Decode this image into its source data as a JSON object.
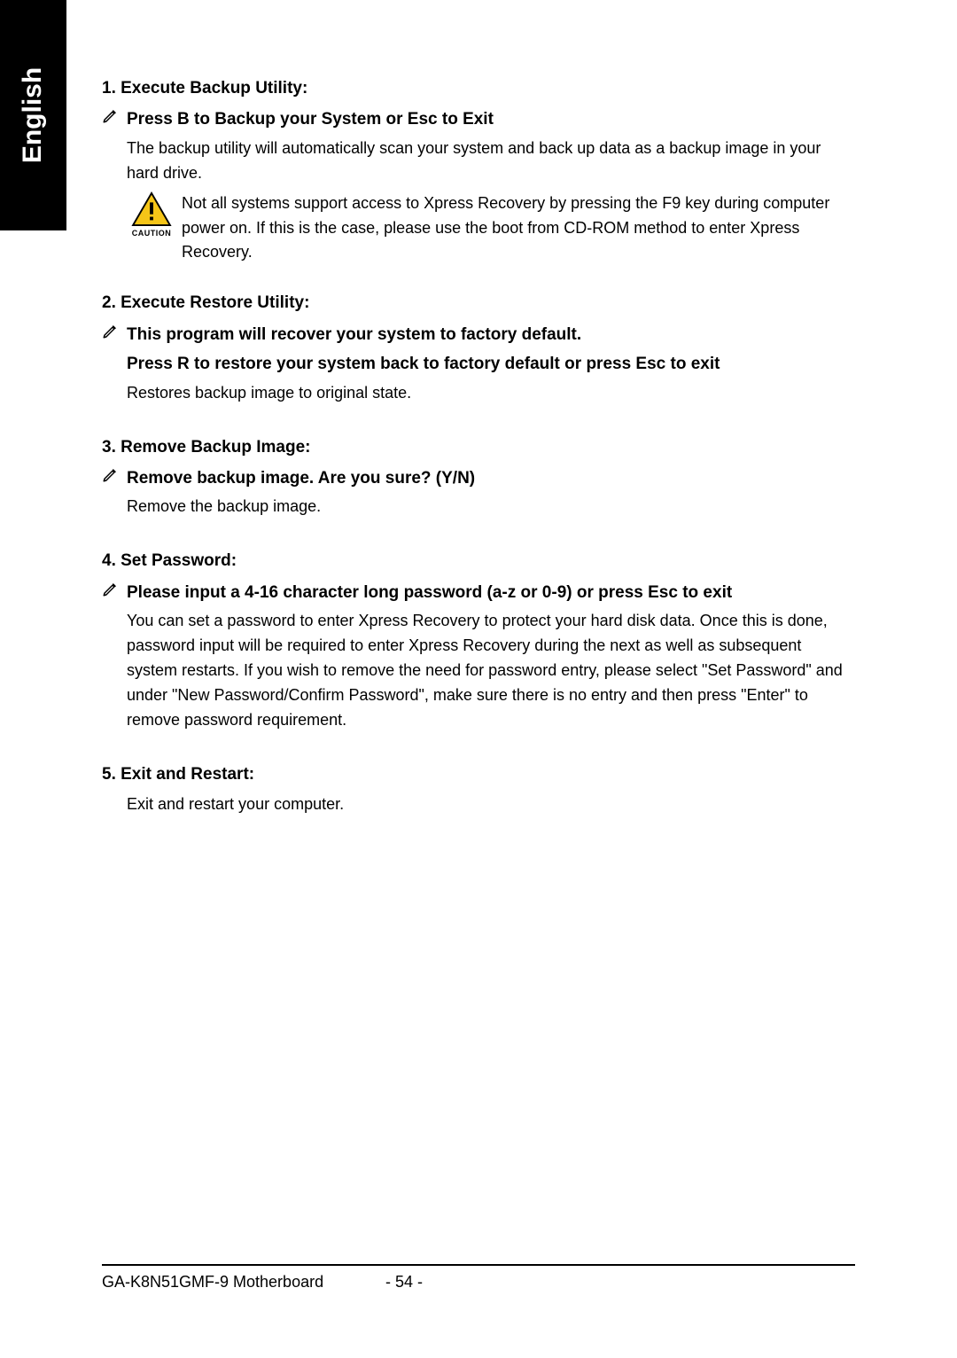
{
  "sidebar": {
    "language": "English"
  },
  "sections": {
    "s1": {
      "heading": "1. Execute Backup Utility:",
      "sub_title": "Press B to Backup your System or Esc to Exit",
      "sub_desc": "The backup utility will automatically scan your system and back up data as a backup image in your hard drive.",
      "caution_label": "CAUTION",
      "caution_text": "Not all systems support access to Xpress Recovery by pressing the F9 key during computer power on. If this is the case, please use the boot from CD-ROM method to enter Xpress Recovery."
    },
    "s2": {
      "heading": "2. Execute Restore Utility:",
      "sub_title1": "This program will recover your system to factory default.",
      "sub_title2": "Press R to restore your system back to factory default or press Esc to exit",
      "sub_desc": "Restores backup image to original state."
    },
    "s3": {
      "heading": "3. Remove Backup Image:",
      "sub_title": "Remove backup image.  Are you sure?  (Y/N)",
      "sub_desc": "Remove the backup image."
    },
    "s4": {
      "heading": "4. Set Password:",
      "sub_title": "Please input a 4-16 character long password (a-z or 0-9) or press Esc to exit",
      "sub_desc": "You can set a password to enter Xpress Recovery to protect your hard disk data.  Once this is done, password input will be required to enter Xpress Recovery during the next as well as subsequent system restarts.  If you wish to remove the need for password entry, please select \"Set Password\" and under \"New Password/Confirm Password\", make sure there is no entry and then press \"Enter\" to remove password requirement."
    },
    "s5": {
      "heading": "5. Exit and Restart:",
      "sub_desc": "Exit and restart your computer."
    }
  },
  "footer": {
    "product": "GA-K8N51GMF-9 Motherboard",
    "page": "- 54 -"
  }
}
